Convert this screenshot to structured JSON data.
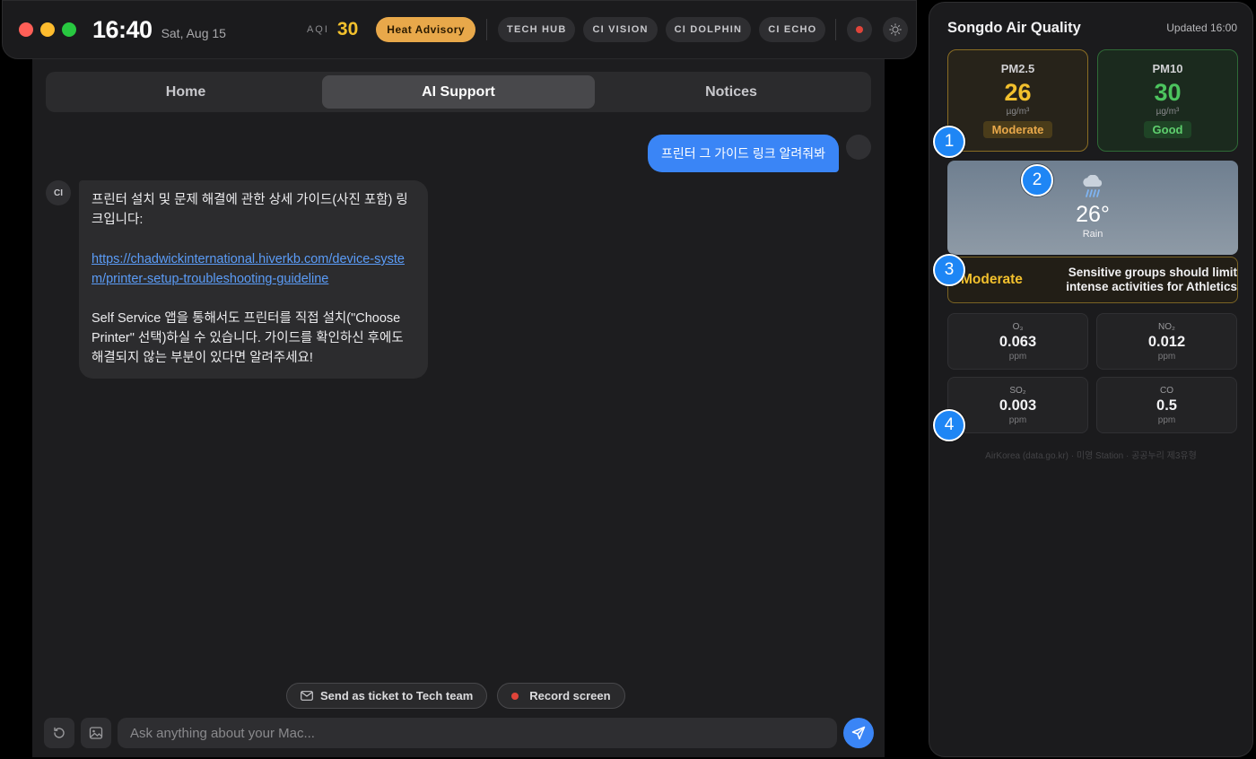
{
  "topbar": {
    "time": "16:40",
    "date": "Sat, Aug 15",
    "aqi_label": "AQI",
    "aqi_value": "30",
    "advisory_badge": "Heat Advisory",
    "pills": [
      "TECH HUB",
      "CI VISION",
      "CI DOLPHIN",
      "CI ECHO"
    ]
  },
  "tabs": [
    "Home",
    "AI Support",
    "Notices"
  ],
  "active_tab": "AI Support",
  "chat": {
    "user_message": "프린터 그 가이드 링크 알려줘봐",
    "bot_avatar": "CI",
    "bot_intro": "프린터 설치 및 문제 해결에 관한 상세 가이드(사진 포함) 링크입니다:",
    "bot_link": "https://chadwickinternational.hiverkb.com/device-system/printer-setup-troubleshooting-guideline",
    "bot_outro": "Self Service 앱을 통해서도 프린터를 직접 설치(\"Choose Printer\" 선택)하실 수 있습니다. 가이드를 확인하신 후에도 해결되지 않는 부분이 있다면 알려주세요!"
  },
  "actions": {
    "ticket_label": "Send as ticket to Tech team",
    "record_label": "Record screen"
  },
  "composer": {
    "placeholder": "Ask anything about your Mac..."
  },
  "air_quality": {
    "title": "Songdo Air Quality",
    "updated": "Updated 16:00",
    "pm25": {
      "name": "PM2.5",
      "value": "26",
      "unit": "µg/m³",
      "status": "Moderate"
    },
    "pm10": {
      "name": "PM10",
      "value": "30",
      "unit": "µg/m³",
      "status": "Good"
    },
    "weather": {
      "temp": "26°",
      "condition": "Rain",
      "icon": "rain-cloud-icon"
    },
    "advisory": {
      "level": "Moderate",
      "text": "Sensitive groups should limit intense activities for Athletics"
    },
    "gases": [
      {
        "name": "O₃",
        "value": "0.063",
        "unit": "ppm"
      },
      {
        "name": "NO₂",
        "value": "0.012",
        "unit": "ppm"
      },
      {
        "name": "SO₂",
        "value": "0.003",
        "unit": "ppm"
      },
      {
        "name": "CO",
        "value": "0.5",
        "unit": "ppm"
      }
    ],
    "source": "AirKorea (data.go.kr) · 미영 Station · 공공누리 제3유형"
  },
  "markers": [
    "1",
    "2",
    "3",
    "4"
  ],
  "colors": {
    "accent_blue": "#3a85f6",
    "heat_badge": "#e8a84a",
    "moderate": "#f2c02d",
    "good": "#4cc45e"
  }
}
